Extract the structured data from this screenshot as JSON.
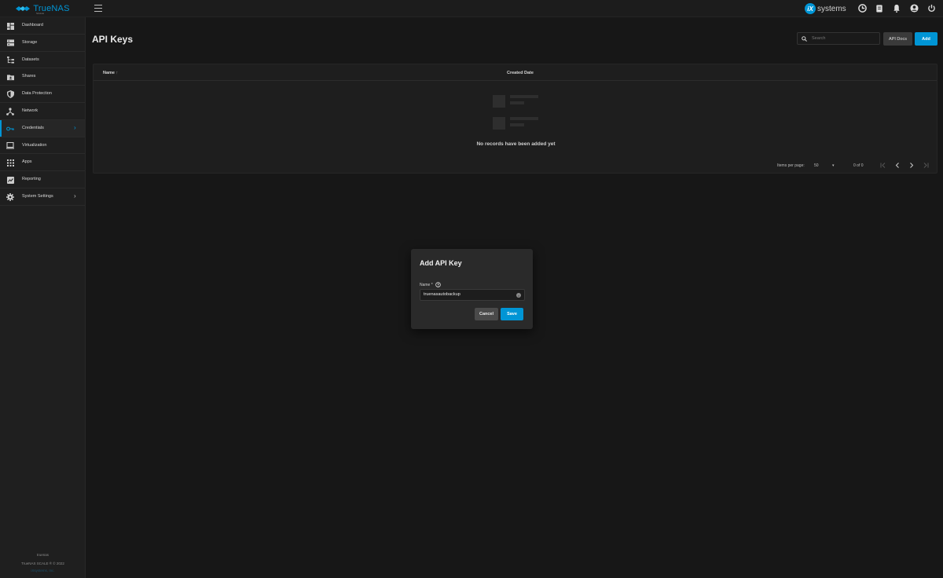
{
  "topbar": {
    "brand_name": "TrueNAS",
    "brand_sub": "SCALE",
    "vendor_logo_badge": "iX",
    "vendor_logo_text": "systems",
    "icons": [
      "truecommand-icon",
      "clipboard-icon",
      "bell-icon",
      "account-icon",
      "power-icon"
    ]
  },
  "sidebar": {
    "items": [
      {
        "label": "Dashboard",
        "icon": "dashboard-icon"
      },
      {
        "label": "Storage",
        "icon": "storage-icon"
      },
      {
        "label": "Datasets",
        "icon": "datasets-icon"
      },
      {
        "label": "Shares",
        "icon": "shares-icon"
      },
      {
        "label": "Data Protection",
        "icon": "shield-icon"
      },
      {
        "label": "Network",
        "icon": "network-icon"
      },
      {
        "label": "Credentials",
        "icon": "key-icon",
        "active": true,
        "has_children": true
      },
      {
        "label": "Virtualization",
        "icon": "laptop-icon"
      },
      {
        "label": "Apps",
        "icon": "apps-grid-icon"
      },
      {
        "label": "Reporting",
        "icon": "reporting-icon"
      },
      {
        "label": "System Settings",
        "icon": "gear-icon",
        "has_children": true
      }
    ],
    "footer_hostname": "truenas",
    "footer_copyright": "TrueNAS SCALE ® © 2022",
    "footer_company": "iXsystems, Inc."
  },
  "page": {
    "title": "API Keys",
    "search_placeholder": "Search",
    "api_docs_label": "API Docs",
    "add_label": "Add"
  },
  "table": {
    "columns": [
      "Name",
      "Created Date"
    ],
    "sort_indicator": "↑",
    "empty_message": "No records have been added yet",
    "items_per_page_label": "Items per page:",
    "items_per_page_value": "50",
    "range_label": "0 of 0"
  },
  "dialog": {
    "title": "Add API Key",
    "name_label": "Name *",
    "name_value": "truenasautobackup",
    "cancel_label": "Cancel",
    "save_label": "Save"
  },
  "colors": {
    "accent": "#0095d5",
    "background": "#171717",
    "sidebar": "#1f1f1f",
    "dialog": "#2a2a2a"
  }
}
